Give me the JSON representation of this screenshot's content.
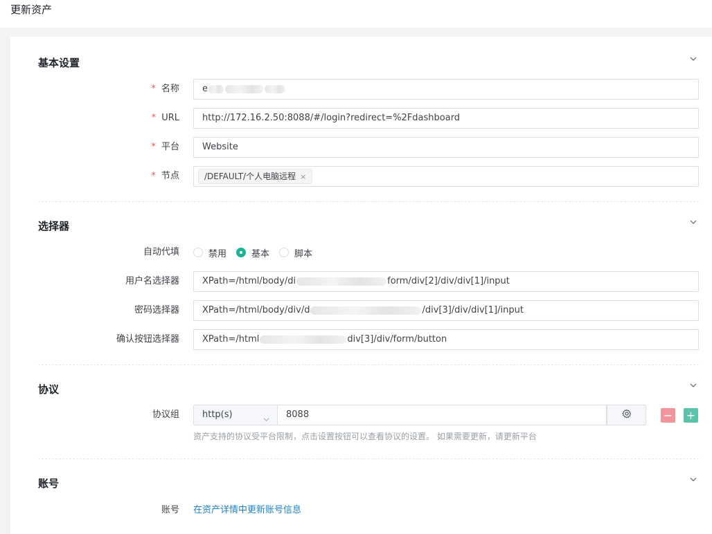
{
  "header": {
    "title": "更新资产"
  },
  "colors": {
    "accent": "#1ab394",
    "required": "#ed5565",
    "link": "#1c84c6",
    "remove": "#f2949c",
    "add": "#5bc3ab"
  },
  "sections": {
    "basic": {
      "title": "基本设置",
      "name": {
        "label": "名称",
        "value_visible": "e"
      },
      "url": {
        "label": "URL",
        "value": "http://172.16.2.50:8088/#/login?redirect=%2Fdashboard"
      },
      "platform": {
        "label": "平台",
        "value": "Website"
      },
      "node": {
        "label": "节点",
        "tag": "/DEFAULT/个人电脑远程",
        "tag_close": "×"
      }
    },
    "selector": {
      "title": "选择器",
      "autofill": {
        "label": "自动代填",
        "options": [
          {
            "label": "禁用",
            "checked": false
          },
          {
            "label": "基本",
            "checked": true
          },
          {
            "label": "脚本",
            "checked": false
          }
        ]
      },
      "username": {
        "label": "用户名选择器",
        "value_start": "XPath=/html/body/di",
        "value_end": "form/div[2]/div/div[1]/input"
      },
      "password": {
        "label": "密码选择器",
        "value_start": "XPath=/html/body/div/d",
        "value_end": "/div[3]/div/div[1]/input"
      },
      "submit": {
        "label": "确认按钮选择器",
        "value_start": "XPath=/html",
        "value_end": "div[3]/div/form/button"
      }
    },
    "protocol": {
      "title": "协议",
      "group": {
        "label": "协议组",
        "protocol": "http(s)",
        "port": "8088",
        "remove": "−",
        "add": "+"
      },
      "hint": "资产支持的协议受平台限制，点击设置按钮可以查看协议的设置。 如果需要更新，请更新平台"
    },
    "account": {
      "title": "账号",
      "label": "账号",
      "link": "在资产详情中更新账号信息"
    }
  },
  "icons": {
    "collapse": "chevron-down-icon",
    "select": "chevron-down-icon",
    "settings": "gear-icon",
    "tag_close": "close-icon"
  }
}
